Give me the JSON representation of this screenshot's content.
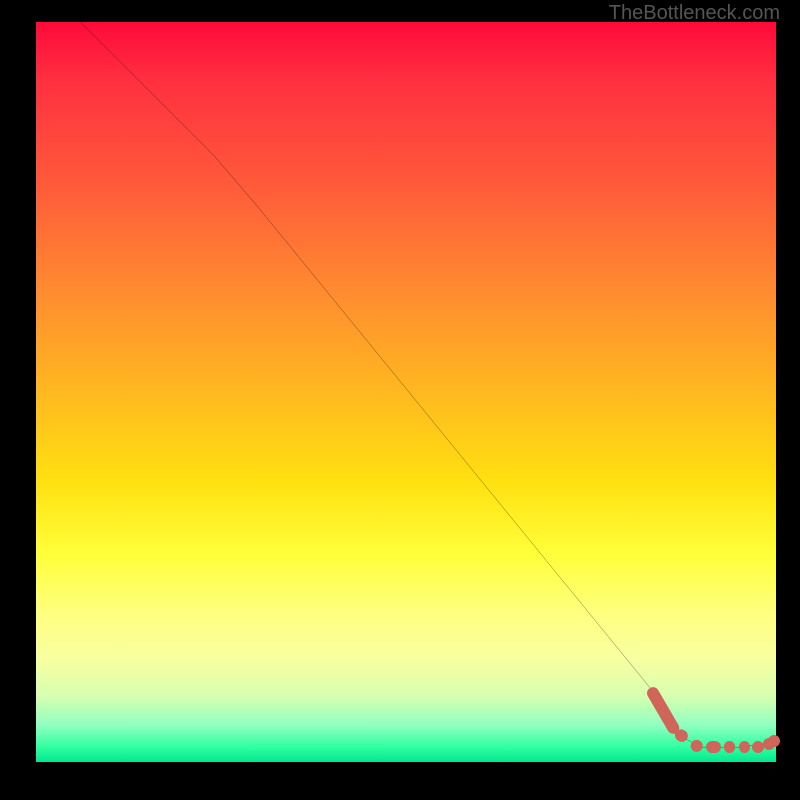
{
  "attribution": "TheBottleneck.com",
  "colors": {
    "marker": "#d0655a",
    "curve": "#000000",
    "top_gradient": "#ff0a3a",
    "bottom_gradient": "#00e890"
  },
  "chart_data": {
    "type": "line",
    "title": "",
    "xlabel": "",
    "ylabel": "",
    "xlim": [
      0,
      100
    ],
    "ylim": [
      0,
      100
    ],
    "grid": false,
    "curve": [
      {
        "x": 6,
        "y": 100
      },
      {
        "x": 24,
        "y": 82
      },
      {
        "x": 30,
        "y": 75
      },
      {
        "x": 83,
        "y": 10
      },
      {
        "x": 86,
        "y": 4
      },
      {
        "x": 90,
        "y": 2
      },
      {
        "x": 95,
        "y": 2
      },
      {
        "x": 98.5,
        "y": 2.5
      },
      {
        "x": 99.5,
        "y": 3
      }
    ],
    "markers": [
      {
        "x": 83,
        "y": 10
      },
      {
        "x": 84,
        "y": 9
      },
      {
        "x": 84.8,
        "y": 7.5
      },
      {
        "x": 85.5,
        "y": 6
      },
      {
        "x": 86,
        "y": 5
      },
      {
        "x": 86.5,
        "y": 4
      },
      {
        "x": 88,
        "y": 3
      },
      {
        "x": 89.5,
        "y": 2
      },
      {
        "x": 91,
        "y": 2
      },
      {
        "x": 92.5,
        "y": 2
      },
      {
        "x": 93.5,
        "y": 2
      },
      {
        "x": 95,
        "y": 2
      },
      {
        "x": 96.5,
        "y": 2
      },
      {
        "x": 97.5,
        "y": 2
      },
      {
        "x": 99,
        "y": 2.5
      },
      {
        "x": 99.7,
        "y": 2.8
      }
    ]
  }
}
